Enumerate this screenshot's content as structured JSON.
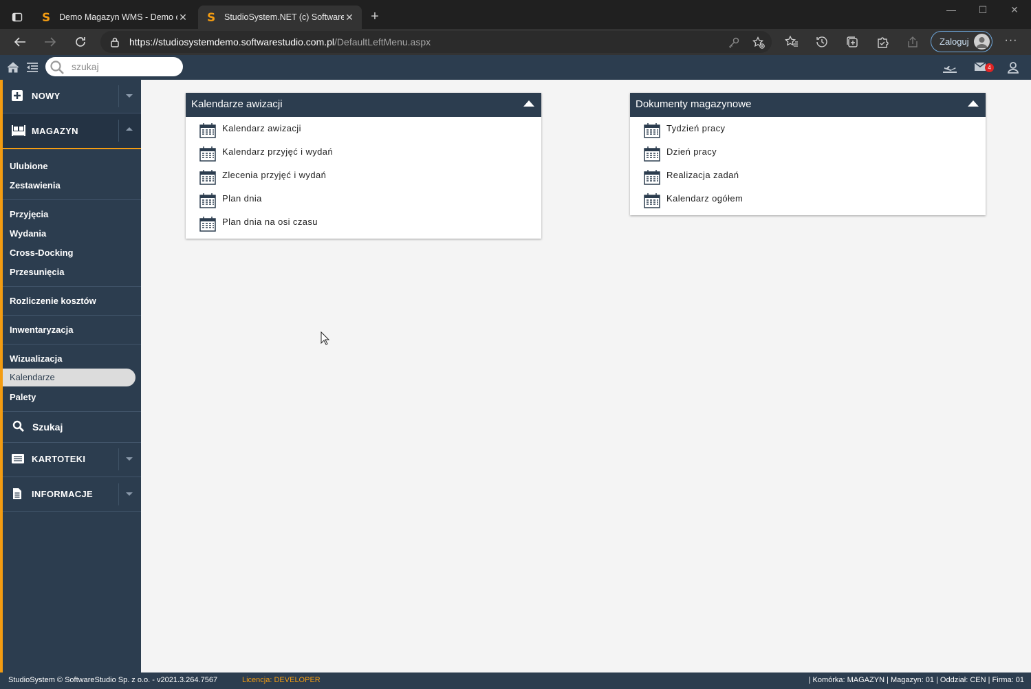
{
  "browser": {
    "tabs": [
      {
        "title": "Demo Magazyn WMS - Demo or"
      },
      {
        "title": "StudioSystem.NET (c) SoftwareSt"
      }
    ],
    "url_host": "https://studiosystemdemo.softwarestudio.com.pl",
    "url_path": "/DefaultLeftMenu.aspx",
    "login_label": "Zaloguj",
    "more_label": "···",
    "colors": {
      "chrome_dark": "#202020",
      "chrome_bar": "#333333",
      "login_border": "#6fa8dc"
    }
  },
  "app": {
    "search_placeholder": "szukaj",
    "mail_count": "4",
    "colors": {
      "primary": "#2c3d4f",
      "accent": "#f39c12",
      "content_bg": "#f4f4f4"
    }
  },
  "sidebar": {
    "sections": {
      "nowy": "NOWY",
      "magazyn": "MAGAZYN",
      "szukaj": "Szukaj",
      "kartoteki": "KARTOTEKI",
      "informacje": "INFORMACJE"
    },
    "items": [
      "Ulubione",
      "Zestawienia",
      "Przyjęcia",
      "Wydania",
      "Cross-Docking",
      "Przesunięcia",
      "Rozliczenie kosztów",
      "Inwentaryzacja",
      "Wizualizacja",
      "Kalendarze",
      "Palety"
    ],
    "active_item": "Kalendarze"
  },
  "panels": [
    {
      "title": "Kalendarze awizacji",
      "items": [
        "Kalendarz awizacji",
        "Kalendarz przyjęć i wydań",
        "Zlecenia przyjęć i wydań",
        "Plan dnia",
        "Plan dnia na osi czasu"
      ]
    },
    {
      "title": "Dokumenty magazynowe",
      "items": [
        "Tydzień pracy",
        "Dzień pracy",
        "Realizacja zadań",
        "Kalendarz ogółem"
      ]
    }
  ],
  "status": {
    "copyright": "StudioSystem © SoftwareStudio Sp. z o.o. - v2021.3.264.7567",
    "license_label": "Licencja:",
    "license_value": "DEVELOPER",
    "context": "| Komórka: MAGAZYN | Magazyn: 01 | Oddział: CEN | Firma: 01"
  }
}
